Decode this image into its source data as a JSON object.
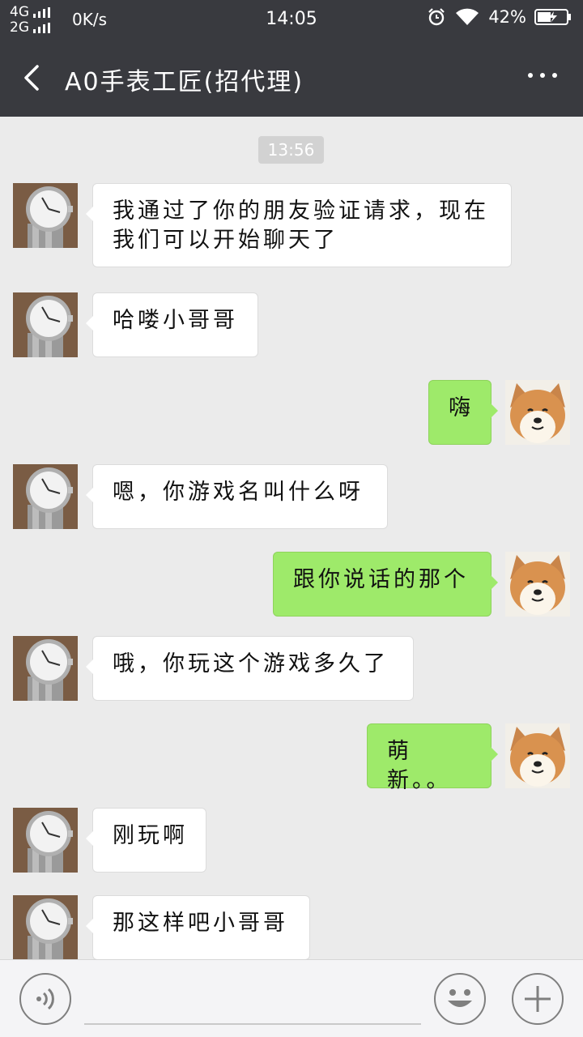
{
  "status_bar": {
    "network_top": "4G",
    "network_bottom": "2G",
    "speed": "0K/s",
    "time": "14:05",
    "battery_percent": "42%"
  },
  "header": {
    "title": "A0手表工匠(招代理)"
  },
  "chat": {
    "timestamp": "13:56",
    "messages": [
      {
        "side": "in",
        "text": "我通过了你的朋友验证请求，现在我们可以开始聊天了"
      },
      {
        "side": "in",
        "text": "哈喽小哥哥"
      },
      {
        "side": "out",
        "text": "嗨"
      },
      {
        "side": "in",
        "text": "嗯，你游戏名叫什么呀"
      },
      {
        "side": "out",
        "text": "跟你说话的那个"
      },
      {
        "side": "in",
        "text": "哦，你玩这个游戏多久了"
      },
      {
        "side": "out",
        "text": "萌新。。"
      },
      {
        "side": "in",
        "text": "刚玩啊"
      },
      {
        "side": "in",
        "text": "那这样吧小哥哥"
      }
    ]
  },
  "input_bar": {
    "voice_icon": "voice-icon",
    "emoji_icon": "emoji-icon",
    "plus_icon": "plus-icon"
  },
  "colors": {
    "header_bg": "#393a3f",
    "chat_bg": "#ebebeb",
    "outgoing_bubble": "#9eea6a",
    "incoming_bubble": "#ffffff"
  }
}
